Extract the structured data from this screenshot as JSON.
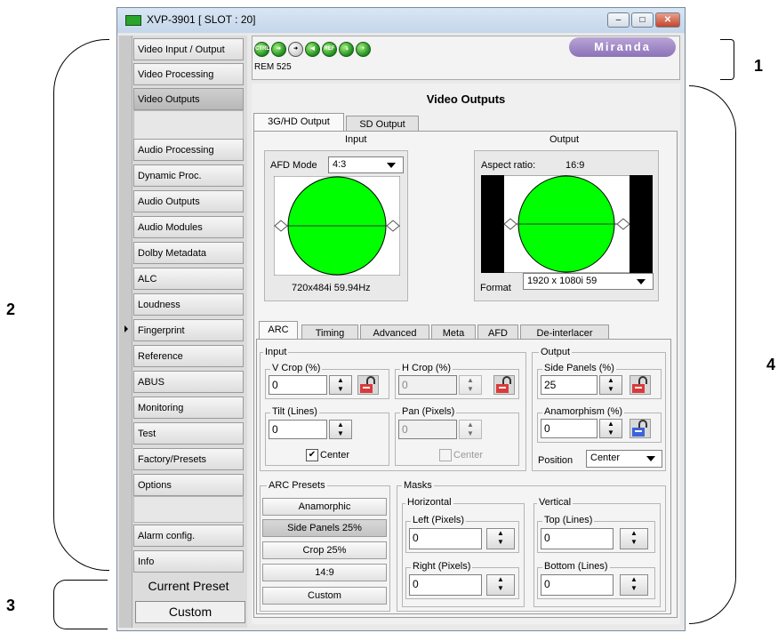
{
  "window": {
    "title": "XVP-3901 [ SLOT : 20]",
    "btn_minimize": "–",
    "btn_maximize": "□",
    "btn_close": "✕"
  },
  "toolbar": {
    "icons": [
      "CTRL",
      "arrow-right",
      "arrow-right",
      "speaker",
      "REF",
      "arrow-down",
      "plus"
    ],
    "rem_text": "REM 525",
    "logo": "Miranda"
  },
  "sidebar": {
    "items": [
      "Video Input / Output",
      "Video Processing",
      "Video Outputs",
      "Audio Processing",
      "Dynamic Proc.",
      "Audio Outputs",
      "Audio Modules",
      "Dolby Metadata",
      "ALC",
      "Loudness",
      "Fingerprint",
      "Reference",
      "ABUS",
      "Monitoring",
      "Test",
      "Factory/Presets",
      "Options",
      "Alarm config.",
      "Info"
    ],
    "current_preset_label": "Current Preset",
    "current_preset_value": "Custom"
  },
  "page_title": "Video Outputs",
  "output_tabs": [
    "3G/HD Output",
    "SD Output"
  ],
  "input_section": {
    "label": "Input",
    "afd_label": "AFD Mode",
    "afd_value": "4:3",
    "format": "720x484i 59.94Hz"
  },
  "output_section": {
    "label": "Output",
    "aspect_label": "Aspect ratio:",
    "aspect_value": "16:9",
    "format_label": "Format",
    "format_value": "1920 x 1080i 59"
  },
  "sub_tabs": [
    "ARC",
    "Timing",
    "Advanced",
    "Meta",
    "AFD",
    "De-interlacer"
  ],
  "arc": {
    "input_group": "Input",
    "v_crop_label": "V Crop (%)",
    "v_crop_value": "0",
    "h_crop_label": "H Crop (%)",
    "h_crop_value": "0",
    "tilt_label": "Tilt (Lines)",
    "tilt_value": "0",
    "pan_label": "Pan (Pixels)",
    "pan_value": "0",
    "center_label": "Center",
    "center_label2": "Center",
    "output_group": "Output",
    "side_panels_label": "Side Panels (%)",
    "side_panels_value": "25",
    "anamorphism_label": "Anamorphism (%)",
    "anamorphism_value": "0",
    "position_label": "Position",
    "position_value": "Center"
  },
  "arc_presets": {
    "title": "ARC Presets",
    "buttons": [
      "Anamorphic",
      "Side Panels 25%",
      "Crop 25%",
      "14:9",
      "Custom"
    ]
  },
  "masks": {
    "title": "Masks",
    "horizontal": "Horizontal",
    "left_label": "Left (Pixels)",
    "left_value": "0",
    "right_label": "Right (Pixels)",
    "right_value": "0",
    "vertical": "Vertical",
    "top_label": "Top (Lines)",
    "top_value": "0",
    "bottom_label": "Bottom (Lines)",
    "bottom_value": "0"
  },
  "callouts": [
    "1",
    "2",
    "3",
    "4"
  ],
  "colors": {
    "circle": "#00ff00",
    "sidebar_bg": "#dcdcdc"
  }
}
